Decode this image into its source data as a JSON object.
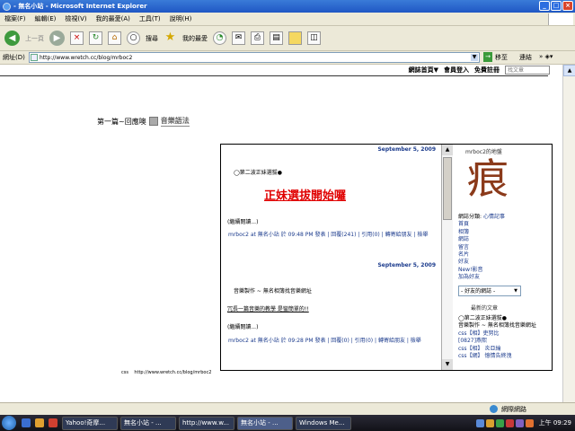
{
  "window": {
    "title": "- 無名小站 - Microsoft Internet Explorer",
    "btn_min": "_",
    "btn_max": "□",
    "btn_close": "×"
  },
  "menu": [
    "檔案(F)",
    "編輯(E)",
    "檢視(V)",
    "我的最愛(A)",
    "工具(T)",
    "說明(H)"
  ],
  "toolbar": {
    "back": "上一頁",
    "search": "搜尋",
    "favorites": "我的最愛"
  },
  "address": {
    "label": "網址(D)",
    "url": "http://www.wretch.cc/blog/mrboc2",
    "go": "移至",
    "links": "連結"
  },
  "topnav": {
    "home": "網誌首頁▼",
    "login": "會員登入",
    "register": "免費註冊",
    "search_placeholder": "找文章"
  },
  "blog": {
    "title": "第一篇~回應噢",
    "category": "音樂語法"
  },
  "posts": [
    {
      "date": "September 5, 2009",
      "head": "◯第二波正妹選拔●",
      "title": "正妹選拔開始囉",
      "read_more": "(繼續閱讀...)",
      "meta": "mrboc2 at 無名小站 於 09:48 PM 發表 | 回覆(241) | 引用(0) | 轉寄給朋友 | 檢舉"
    },
    {
      "date": "September 5, 2009",
      "line1": "音樂製作 ~ 無名相簿找音樂網址",
      "line2": "冗長一篇音樂的教學  是蠻簡單的!!",
      "read_more": "(繼續閱讀...)",
      "meta": "mrboc2 at 無名小站 於 09:28 PM 發表 | 回覆(0) | 引用(0) | 轉寄給朋友 | 檢舉"
    }
  ],
  "sidebar": {
    "title": "mrboc2的地盤",
    "avatar_char": "痕",
    "category_label": "網誌分類:",
    "category_link": "心情記事",
    "links": [
      "首頁",
      "相簿",
      "網誌",
      "留言",
      "名片",
      "好友",
      "New!影音",
      "加為好友"
    ],
    "friends_select": "- 好友的網誌 -",
    "recent_title": "最新的文章",
    "recent": [
      "◯第二波正妹選拔●",
      "音樂製作 ~ 無名相簿找音樂網址",
      "css【相】吏努比",
      "[0827]燕熙",
      "css【相】 炎亞綸",
      "css【網】 憶情告終洩"
    ]
  },
  "footer": {
    "css_label": "css",
    "css_url": "http://www.wretch.cc/blog/mrboc2"
  },
  "status": {
    "zone": "網際網路"
  },
  "taskbar": {
    "tasks": [
      "Yahoo!奇摩...",
      "無名小站 - ...",
      "http://www.w...",
      "無名小站 - ...",
      "Windows Me..."
    ],
    "clock": "上午 09:29"
  }
}
